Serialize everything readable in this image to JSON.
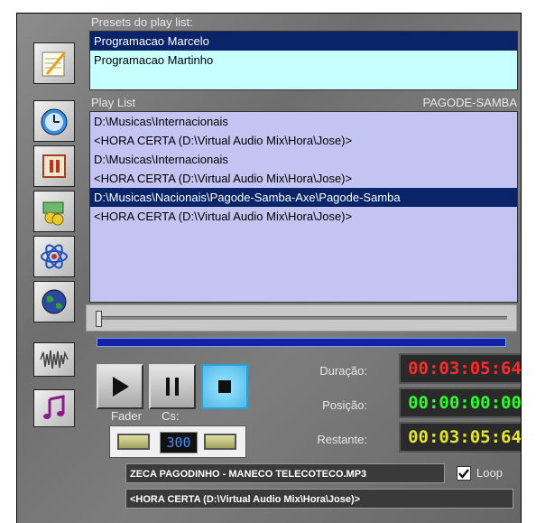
{
  "presets": {
    "title": "Presets do play list:",
    "items": [
      "Programacao Marcelo",
      "Programacao Martinho"
    ],
    "selected_index": 0
  },
  "playlist": {
    "title": "Play List",
    "genre": "PAGODE-SAMBA",
    "items": [
      "D:\\Musicas\\Internacionais",
      "<HORA CERTA (D:\\Virtual Audio Mix\\Hora\\Jose)>",
      "D:\\Musicas\\Internacionais",
      "<HORA CERTA (D:\\Virtual Audio Mix\\Hora\\Jose)>",
      "D:\\Musicas\\Nacionais\\Pagode-Samba-Axe\\Pagode-Samba",
      "<HORA CERTA (D:\\Virtual Audio Mix\\Hora\\Jose)>"
    ],
    "selected_index": 4
  },
  "sidebar_icons": [
    "notepad-icon",
    "clock-icon",
    "pause-icon",
    "money-icon",
    "atom-icon",
    "globe-icon",
    "waveform-icon",
    "music-note-icon"
  ],
  "fader": {
    "label": "Fader",
    "cs_label": "Cs:",
    "value": "300"
  },
  "timers": {
    "duracao_label": "Duração:",
    "duracao_value": "00:03:05:64",
    "posicao_label": "Posição:",
    "posicao_value": "00:00:00:00",
    "restante_label": "Restante:",
    "restante_value": "00:03:05:64",
    "colors": {
      "duracao": "#ff2a2a",
      "posicao": "#2aff2a",
      "restante": "#e6e62a"
    }
  },
  "now_playing": "ZECA PAGODINHO - MANECO TELECOTECO.MP3",
  "next_item": "<HORA CERTA (D:\\Virtual Audio Mix\\Hora\\Jose)>",
  "loop": {
    "label": "Loop",
    "checked": true
  },
  "progress": 0
}
